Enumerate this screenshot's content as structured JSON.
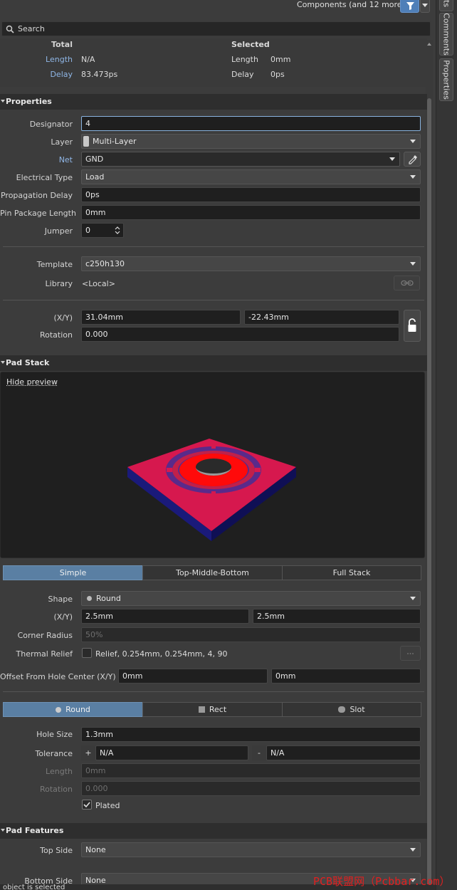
{
  "header": {
    "components_label": "Components (and 12 more)"
  },
  "search": {
    "placeholder": "Search"
  },
  "summary": {
    "total_label": "Total",
    "selected_label": "Selected",
    "length_label": "Length",
    "delay_label": "Delay",
    "total_length": "N/A",
    "total_delay": "83.473ps",
    "sel_length": "0mm",
    "sel_delay": "0ps"
  },
  "properties": {
    "title": "Properties",
    "designator_label": "Designator",
    "designator": "4",
    "layer_label": "Layer",
    "layer": "Multi-Layer",
    "net_label": "Net",
    "net": "GND",
    "etype_label": "Electrical Type",
    "etype": "Load",
    "pdelay_label": "Propagation Delay",
    "pdelay": "0ps",
    "ppl_label": "Pin Package Length",
    "ppl": "0mm",
    "jumper_label": "Jumper",
    "jumper": "0",
    "template_label": "Template",
    "template": "c250h130",
    "library_label": "Library",
    "library": "<Local>",
    "xy_label": "(X/Y)",
    "x": "31.04mm",
    "y": "-22.43mm",
    "rotation_label": "Rotation",
    "rotation": "0.000"
  },
  "padstack": {
    "title": "Pad Stack",
    "hide_preview": "Hide preview",
    "modes": [
      "Simple",
      "Top-Middle-Bottom",
      "Full Stack"
    ],
    "shape_label": "Shape",
    "shape": "Round",
    "xy_label": "(X/Y)",
    "sx": "2.5mm",
    "sy": "2.5mm",
    "corner_label": "Corner Radius",
    "corner": "50%",
    "thermal_label": "Thermal Relief",
    "thermal": "Relief, 0.254mm, 0.254mm, 4, 90",
    "offset_label": "Offset From Hole Center (X/Y)",
    "ox": "0mm",
    "oy": "0mm",
    "holes": [
      "Round",
      "Rect",
      "Slot"
    ],
    "holesize_label": "Hole Size",
    "holesize": "1.3mm",
    "tol_label": "Tolerance",
    "tol_plus": "N/A",
    "tol_minus": "N/A",
    "hlen_label": "Length",
    "hlen": "0mm",
    "hrot_label": "Rotation",
    "hrot": "0.000",
    "plated_label": "Plated"
  },
  "features": {
    "title": "Pad Features",
    "top_label": "Top Side",
    "top": "None",
    "bottom_label": "Bottom Side",
    "bottom": "None"
  },
  "status": {
    "text": "object is selected"
  },
  "side_tabs": [
    "ts",
    "Comments",
    "Properties"
  ],
  "watermark": "PCB联盟网（Pcbbar.com）",
  "colors": {
    "accent": "#5a7fa3",
    "pad": "#d6184e",
    "copper_ring": "#ff0a0a",
    "board_side": "#1a1a7a"
  }
}
